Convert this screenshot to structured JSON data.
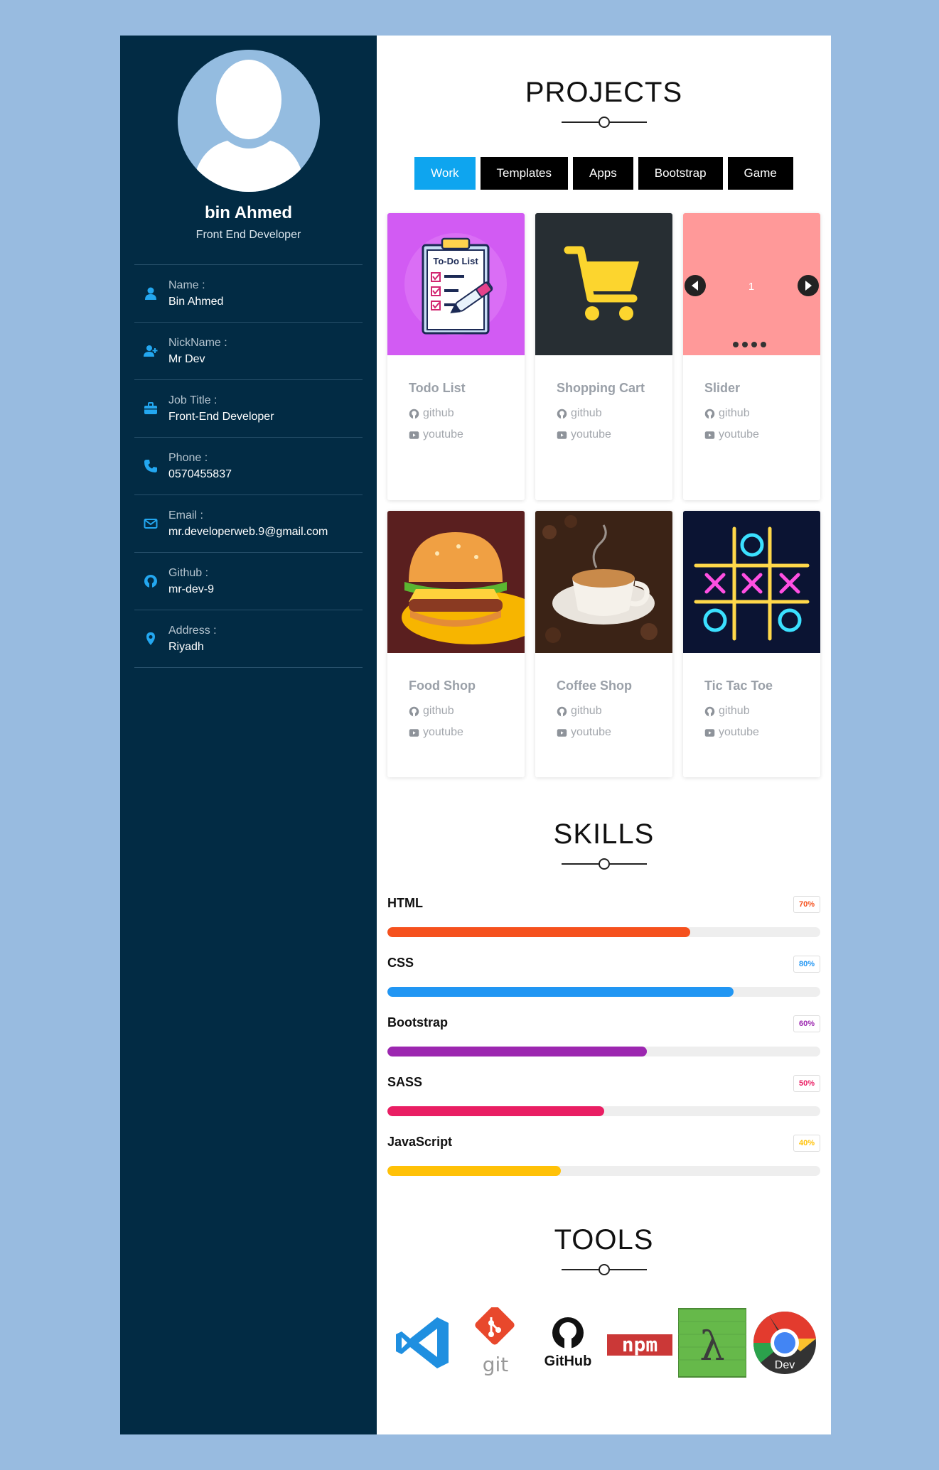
{
  "profile": {
    "name": "bin Ahmed",
    "role": "Front End Developer"
  },
  "info": [
    {
      "icon": "user-icon",
      "label": "Name :",
      "value": "Bin Ahmed"
    },
    {
      "icon": "user-plus-icon",
      "label": "NickName :",
      "value": "Mr Dev"
    },
    {
      "icon": "briefcase-icon",
      "label": "Job Title :",
      "value": "Front-End Developer"
    },
    {
      "icon": "phone-icon",
      "label": "Phone :",
      "value": "0570455837"
    },
    {
      "icon": "envelope-icon",
      "label": "Email :",
      "value": "mr.developerweb.9@gmail.com"
    },
    {
      "icon": "github-icon",
      "label": "Github :",
      "value": "mr-dev-9"
    },
    {
      "icon": "location-icon",
      "label": "Address :",
      "value": "Riyadh"
    }
  ],
  "projects": {
    "title": "PROJECTS",
    "filters": [
      "Work",
      "Templates",
      "Apps",
      "Bootstrap",
      "Game"
    ],
    "active_filter": "Work",
    "cards": [
      {
        "title": "Todo List",
        "github": "github",
        "youtube": "youtube",
        "thumb_text": "To-Do List"
      },
      {
        "title": "Shopping Cart",
        "github": "github",
        "youtube": "youtube"
      },
      {
        "title": "Slider",
        "github": "github",
        "youtube": "youtube",
        "thumb_text": "1"
      },
      {
        "title": "Food Shop",
        "github": "github",
        "youtube": "youtube"
      },
      {
        "title": "Coffee Shop",
        "github": "github",
        "youtube": "youtube"
      },
      {
        "title": "Tic Tac Toe",
        "github": "github",
        "youtube": "youtube"
      }
    ]
  },
  "skills": {
    "title": "SKILLS",
    "items": [
      {
        "name": "HTML",
        "percent_label": "70%",
        "value": 0.7,
        "color": "#f5511e"
      },
      {
        "name": "CSS",
        "percent_label": "80%",
        "value": 0.8,
        "color": "#2196f3"
      },
      {
        "name": "Bootstrap",
        "percent_label": "60%",
        "value": 0.6,
        "color": "#9c27b0"
      },
      {
        "name": "SASS",
        "percent_label": "50%",
        "value": 0.5,
        "color": "#e91e63"
      },
      {
        "name": "JavaScript",
        "percent_label": "40%",
        "value": 0.4,
        "color": "#ffc107"
      }
    ]
  },
  "tools": {
    "title": "TOOLS",
    "items": [
      {
        "icon": "vscode-icon"
      },
      {
        "icon": "git-icon",
        "text": "git"
      },
      {
        "icon": "github-logo-icon",
        "text": "GitHub"
      },
      {
        "icon": "npm-icon",
        "text": "npm"
      },
      {
        "icon": "lambda-icon",
        "text": "λ"
      },
      {
        "icon": "chrome-dev-icon",
        "text": "Dev"
      }
    ]
  },
  "colors": {
    "sidebar_bg": "#022b44",
    "accent": "#0ea5ef",
    "page_bg": "#98bbe0"
  }
}
